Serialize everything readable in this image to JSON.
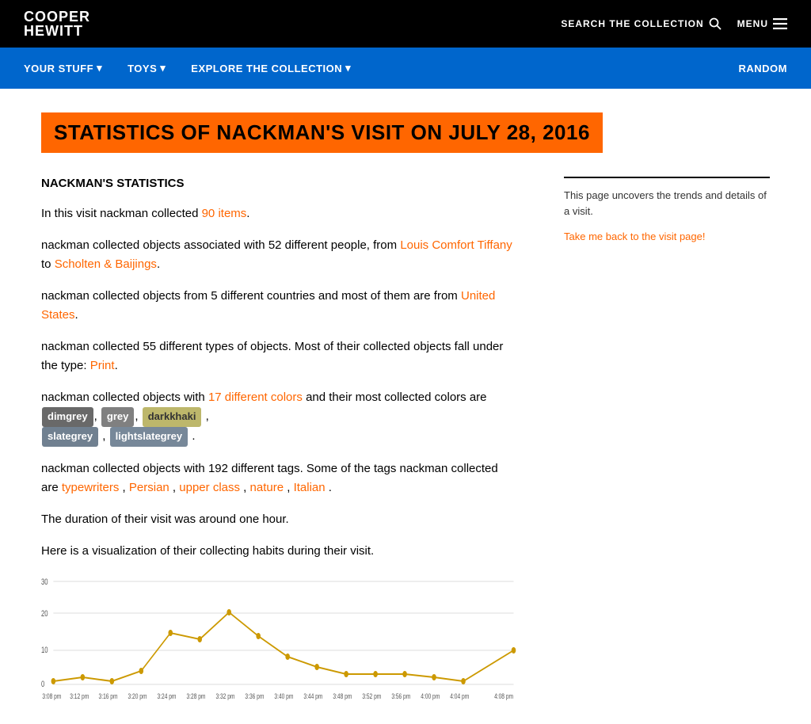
{
  "header": {
    "logo_line1": "COOPER",
    "logo_line2": "HEWITT",
    "search_label": "SEARCH THE COLLECTION",
    "menu_label": "MENU"
  },
  "navbar": {
    "items": [
      {
        "label": "YOUR STUFF",
        "has_arrow": true
      },
      {
        "label": "TOYS",
        "has_arrow": true
      },
      {
        "label": "EXPLORE THE COLLECTION",
        "has_arrow": true
      }
    ],
    "random_label": "RANDOM"
  },
  "page": {
    "title": "STATISTICS OF NACKMAN'S VISIT ON JULY 28, 2016"
  },
  "right_col": {
    "description": "This page uncovers the trends and details of a visit.",
    "link_label": "Take me back to the visit page!"
  },
  "stats": {
    "heading": "NACKMAN'S STATISTICS",
    "para1_prefix": "In this visit nackman collected ",
    "para1_count": "90 items",
    "para1_suffix": ".",
    "para2": "nackman collected objects associated with 52 different people, from ",
    "para2_link1": "Louis Comfort Tiffany",
    "para2_mid": " to ",
    "para2_link2": "Scholten & Baijings",
    "para2_suffix": ".",
    "para3_prefix": "nackman collected objects from 5 different countries and most of them are from ",
    "para3_link": "United States",
    "para3_suffix": ".",
    "para4_prefix": "nackman collected 55 different types of objects. Most of their collected objects fall under the type: ",
    "para4_link": "Print",
    "para4_suffix": ".",
    "para5_prefix": "nackman collected objects with ",
    "para5_link": "17 different colors",
    "para5_mid": " and their most collected colors are ",
    "para5_suffix": " .",
    "colors": [
      "dimgrey",
      "grey",
      "darkkhaki",
      "slategrey",
      "lightslategrey"
    ],
    "para6_prefix": "nackman collected objects with 192 different tags. Some of the tags nackman collected are ",
    "para6_tags": [
      "typewriters",
      "Persian",
      "upper class",
      "nature",
      "Italian"
    ],
    "para6_suffix": ".",
    "para7": "The duration of their visit was around one hour.",
    "para8": "Here is a visualization of their collecting habits during their visit."
  },
  "chart": {
    "y_labels": [
      "30",
      "20",
      "10",
      "0"
    ],
    "x_labels": [
      "3:08 pm",
      "3:12 pm",
      "3:16 pm",
      "3:20 pm",
      "3:24 pm",
      "3:28 pm",
      "3:32 pm",
      "3:36 pm",
      "3:40 pm",
      "3:44 pm",
      "3:48 pm",
      "3:52 pm",
      "3:56 pm",
      "4:00 pm",
      "4:04 pm",
      "4:08 pm"
    ],
    "data_points": [
      1,
      2,
      1,
      3,
      15,
      13,
      21,
      12,
      8,
      5,
      3,
      3,
      3,
      2,
      1,
      10
    ]
  }
}
